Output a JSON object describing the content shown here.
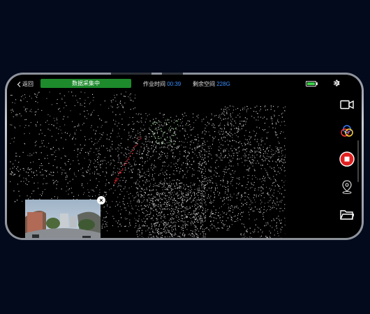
{
  "topbar": {
    "back_label": "返回",
    "status_label": "数据采集中",
    "worktime_label": "作业时间",
    "worktime_value": "00:39",
    "space_label": "剩余空间",
    "space_value": "228G",
    "battery_level": 0.85
  },
  "icons": {
    "back": "chevron-left-icon",
    "battery": "battery-icon",
    "settings": "gear-icon",
    "camera": "video-camera-icon",
    "color": "color-circles-icon",
    "record": "stop-record-icon",
    "location": "location-pin-icon",
    "folder": "folder-icon",
    "close": "close-icon"
  },
  "colors": {
    "status_green": "#1d8a2c",
    "value_blue": "#3b8fff",
    "record_red": "#e02020",
    "background": "#020a1c"
  },
  "pip": {
    "close_label": "×"
  }
}
